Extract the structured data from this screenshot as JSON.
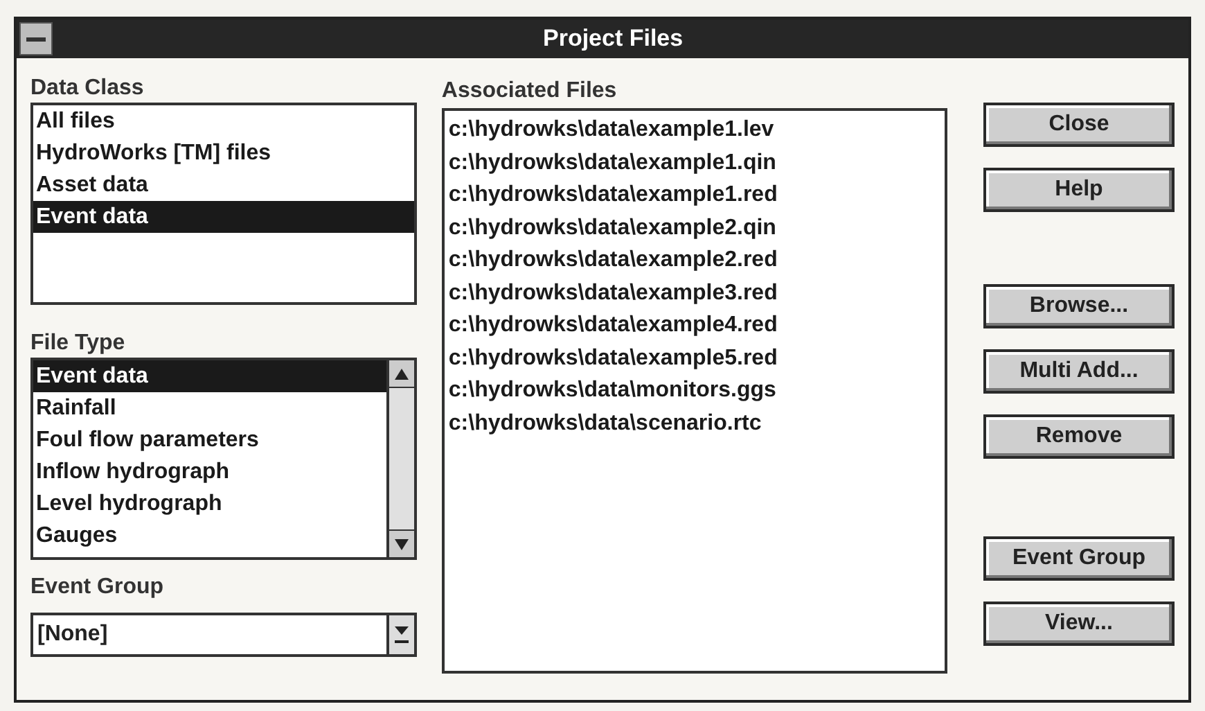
{
  "window": {
    "title": "Project Files"
  },
  "data_class": {
    "label": "Data Class",
    "items": [
      {
        "label": "All files",
        "selected": false
      },
      {
        "label": "HydroWorks [TM] files",
        "selected": false
      },
      {
        "label": "Asset data",
        "selected": false
      },
      {
        "label": "Event data",
        "selected": true
      }
    ]
  },
  "file_type": {
    "label": "File Type",
    "items": [
      {
        "label": "Event data",
        "selected": true
      },
      {
        "label": "Rainfall",
        "selected": false
      },
      {
        "label": "Foul flow parameters",
        "selected": false
      },
      {
        "label": "Inflow hydrograph",
        "selected": false
      },
      {
        "label": "Level hydrograph",
        "selected": false
      },
      {
        "label": "Gauges",
        "selected": false
      }
    ]
  },
  "event_group": {
    "label": "Event Group",
    "value": "[None]"
  },
  "associated_files": {
    "label": "Associated Files",
    "items": [
      "c:\\hydrowks\\data\\example1.lev",
      "c:\\hydrowks\\data\\example1.qin",
      "c:\\hydrowks\\data\\example1.red",
      "c:\\hydrowks\\data\\example2.qin",
      "c:\\hydrowks\\data\\example2.red",
      "c:\\hydrowks\\data\\example3.red",
      "c:\\hydrowks\\data\\example4.red",
      "c:\\hydrowks\\data\\example5.red",
      "c:\\hydrowks\\data\\monitors.ggs",
      "c:\\hydrowks\\data\\scenario.rtc"
    ]
  },
  "button_groups": [
    [
      "Close",
      "Help"
    ],
    [
      "Browse...",
      "Multi Add...",
      "Remove"
    ],
    [
      "Event Group",
      "View..."
    ]
  ]
}
